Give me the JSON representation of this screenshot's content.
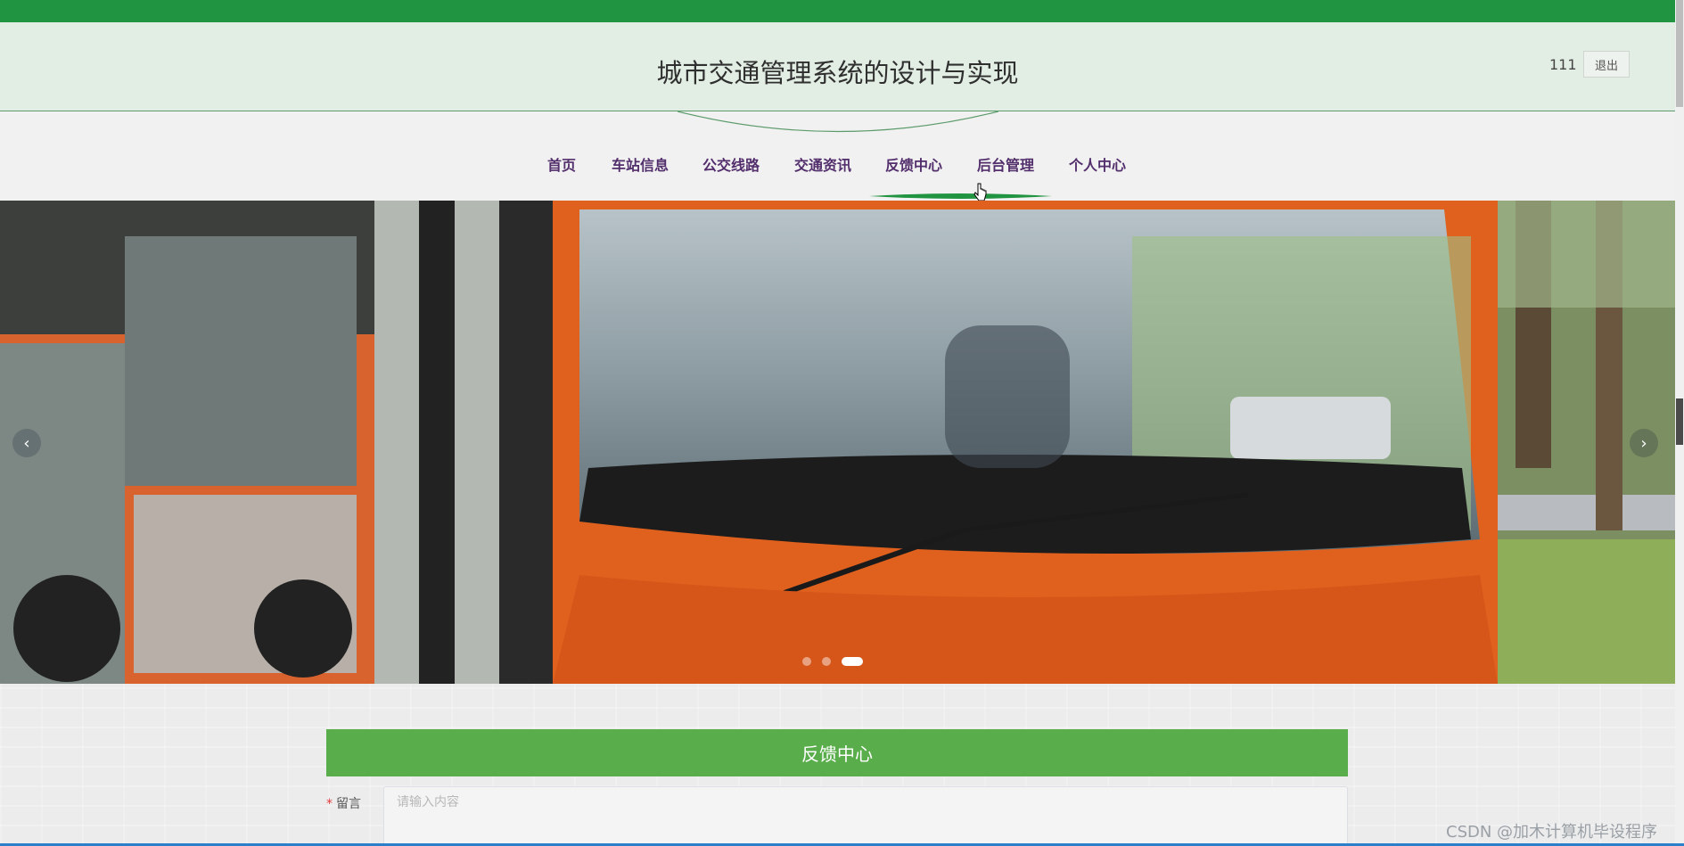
{
  "header": {
    "title": "城市交通管理系统的设计与实现",
    "username": "111",
    "logout_label": "退出"
  },
  "nav": {
    "items": [
      "首页",
      "车站信息",
      "公交线路",
      "交通资讯",
      "反馈中心",
      "后台管理",
      "个人中心"
    ],
    "active_index": 4
  },
  "carousel": {
    "prev_icon": "‹",
    "next_icon": "›",
    "slide_count": 3,
    "active_slide": 3
  },
  "feedback": {
    "section_title": "反馈中心",
    "message_label": "留言",
    "required_mark": "*",
    "message_placeholder": "请输入内容",
    "message_value": ""
  },
  "watermark": "CSDN @加木计算机毕设程序",
  "colors": {
    "brand_green": "#219441",
    "section_green": "#5aad4b",
    "nav_text": "#522e6c"
  }
}
